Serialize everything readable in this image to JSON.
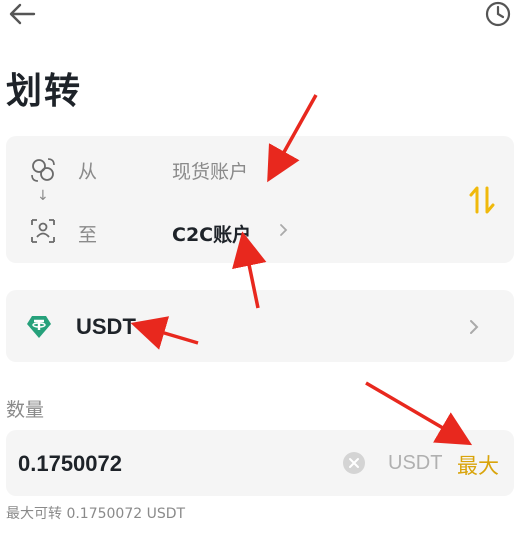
{
  "header": {
    "back_icon": "arrow-left-icon",
    "history_icon": "clock-icon"
  },
  "page": {
    "title": "划转"
  },
  "transfer": {
    "from_label": "从",
    "from_value": "现货账户",
    "to_label": "至",
    "to_value": "C2C账户",
    "from_icon": "wallet-exchange-icon",
    "to_icon": "user-account-icon",
    "swap_icon": "swap-vertical-icon",
    "swap_color": "#f0b90b"
  },
  "coin": {
    "name": "USDT",
    "icon": "tether-icon",
    "icon_color": "#26a17b"
  },
  "amount": {
    "label": "数量",
    "value": "0.1750072",
    "unit": "USDT",
    "max_label": "最大",
    "max_color": "#d9a40b"
  },
  "available": {
    "text": "最大可转 0.1750072 USDT"
  },
  "annotation_color": "#e8281e"
}
